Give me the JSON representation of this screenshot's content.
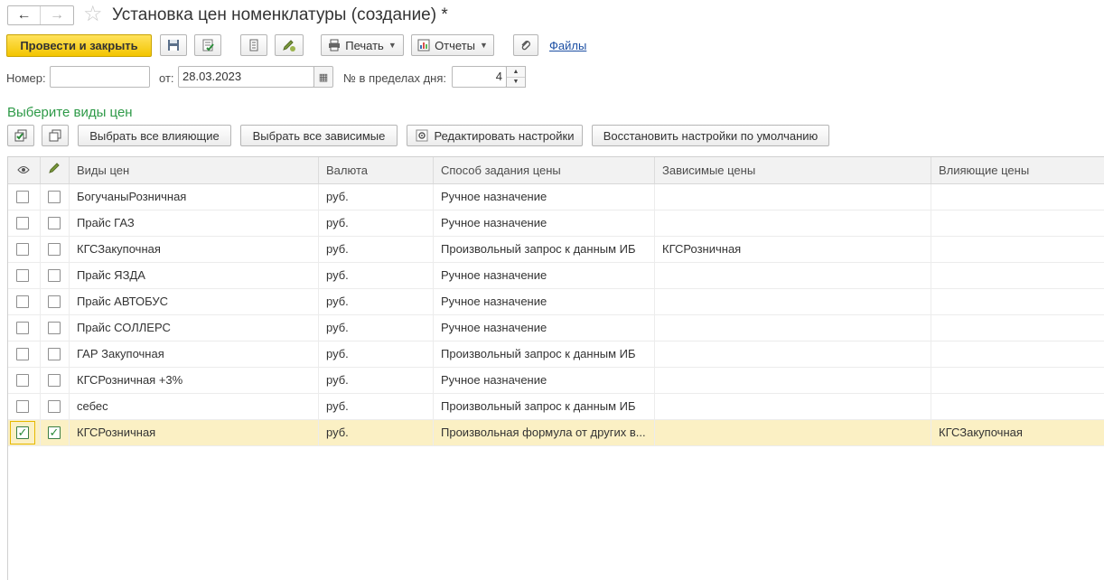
{
  "window": {
    "title": "Установка цен номенклатуры (создание) *",
    "nav_back": "←",
    "nav_forward": "→",
    "favorite_icon": "star-icon"
  },
  "toolbar": {
    "post_and_close": "Провести и закрыть",
    "print_label": "Печать",
    "reports_label": "Отчеты",
    "files_link": "Файлы"
  },
  "fields": {
    "number_label": "Номер:",
    "number_value": "",
    "from_label": "от:",
    "date_value": "28.03.2023",
    "day_order_label": "№ в пределах дня:",
    "day_order_value": "4"
  },
  "section": {
    "title": "Выберите виды цен",
    "buttons": {
      "select_influencing": "Выбрать все влияющие",
      "select_dependent": "Выбрать все зависимые",
      "edit_settings": "Редактировать настройки",
      "restore_defaults": "Восстановить настройки по умолчанию"
    }
  },
  "table": {
    "columns": [
      "Виды цен",
      "Валюта",
      "Способ задания цены",
      "Зависимые цены",
      "Влияющие цены"
    ],
    "rows": [
      {
        "visible": false,
        "edit": false,
        "name": "БогучаныРозничная",
        "currency": "руб.",
        "method": "Ручное назначение",
        "dependent": "",
        "influencing": ""
      },
      {
        "visible": false,
        "edit": false,
        "name": "Прайс ГАЗ",
        "currency": "руб.",
        "method": "Ручное назначение",
        "dependent": "",
        "influencing": ""
      },
      {
        "visible": false,
        "edit": false,
        "name": "КГСЗакупочная",
        "currency": "руб.",
        "method": "Произвольный запрос к данным ИБ",
        "dependent": "КГСРозничная",
        "influencing": ""
      },
      {
        "visible": false,
        "edit": false,
        "name": "Прайс ЯЗДА",
        "currency": "руб.",
        "method": "Ручное назначение",
        "dependent": "",
        "influencing": ""
      },
      {
        "visible": false,
        "edit": false,
        "name": "Прайс АВТОБУС",
        "currency": "руб.",
        "method": "Ручное назначение",
        "dependent": "",
        "influencing": ""
      },
      {
        "visible": false,
        "edit": false,
        "name": "Прайс СОЛЛЕРС",
        "currency": "руб.",
        "method": "Ручное назначение",
        "dependent": "",
        "influencing": ""
      },
      {
        "visible": false,
        "edit": false,
        "name": "ГАР Закупочная",
        "currency": "руб.",
        "method": "Произвольный запрос к данным ИБ",
        "dependent": "",
        "influencing": ""
      },
      {
        "visible": false,
        "edit": false,
        "name": "КГСРозничная +3%",
        "currency": "руб.",
        "method": "Ручное назначение",
        "dependent": "",
        "influencing": ""
      },
      {
        "visible": false,
        "edit": false,
        "name": "себес",
        "currency": "руб.",
        "method": "Произвольный запрос к данным ИБ",
        "dependent": "",
        "influencing": ""
      },
      {
        "visible": true,
        "edit": true,
        "name": "КГСРозничная",
        "currency": "руб.",
        "method": "Произвольная формула от других в...",
        "dependent": "",
        "influencing": "КГСЗакупочная",
        "selected": true
      }
    ]
  },
  "colors": {
    "primary_button": "#f3c500",
    "section_title": "#2e9a48",
    "selected_row": "#fbf0c4",
    "link": "#1c4fa3"
  }
}
